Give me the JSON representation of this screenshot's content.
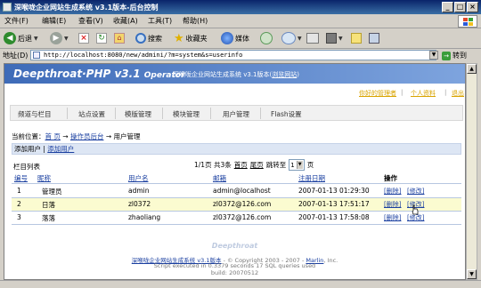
{
  "window": {
    "title": "深喉咙企业网站生成系统 v3.1版本-后台控制"
  },
  "menu": {
    "items": [
      "文件(F)",
      "编辑(E)",
      "查看(V)",
      "收藏(A)",
      "工具(T)",
      "帮助(H)"
    ]
  },
  "toolbar": {
    "back_label": "后退",
    "search_label": "搜索",
    "favorites_label": "收藏夹",
    "media_label": "媒体"
  },
  "address": {
    "label": "地址(D)",
    "url": "http://localhost:8080/new/admini/?m=system&s=userinfo",
    "go_label": "转到"
  },
  "page": {
    "brand": "Deepthroat·PHP v3.1",
    "brand_sub": "Operator",
    "header_text": "深喉咙企业网站生成系统 v3.1版本",
    "header_link": "浏览网站",
    "user_links": {
      "admin": "你好的管理者",
      "profile": "个人资料",
      "logout": "退出"
    },
    "tabs": [
      "频道与栏目",
      "站点设置",
      "模版管理",
      "模块管理",
      "用户管理",
      "Flash设置"
    ],
    "breadcrumb": {
      "prefix": "当前位置：",
      "home": "首 页",
      "sep1": " → ",
      "backend": "操作员后台",
      "sep2": " → ",
      "current": "用户管理"
    },
    "actions": {
      "add_user_label": "添加用户",
      "add_user_link": "添加用户"
    },
    "list_title": "栏目列表",
    "pager": {
      "summary": "1/1页 共3条",
      "first": "首页",
      "last": "尾页",
      "jump_label": "跳转至",
      "page_value": "1",
      "page_suffix": "页"
    },
    "table": {
      "headers": {
        "id": "编号",
        "nickname": "昵称",
        "username": "用户名",
        "email": "邮箱",
        "regdate": "注册日期",
        "ops": "操作"
      },
      "rows": [
        {
          "id": "1",
          "nickname": "管理员",
          "username": "admin",
          "email": "admin@localhost",
          "regdate": "2007-01-13 01:29:30",
          "delete": "[删除]",
          "edit": "[修改]"
        },
        {
          "id": "2",
          "nickname": "日落",
          "username": "zl0372",
          "email": "zl0372@126.com",
          "regdate": "2007-01-13 17:51:17",
          "delete": "[删除]",
          "edit": "[修改]"
        },
        {
          "id": "3",
          "nickname": "落落",
          "username": "zhaoliang",
          "email": "zl0372@126.com",
          "regdate": "2007-01-13 17:58:08",
          "delete": "[删除]",
          "edit": "[修改]"
        }
      ]
    },
    "footer": {
      "brand": "Deepthroat",
      "line1_link": "深喉咙企业网站生成系统 v3.1版本",
      "line1_mid": " - © Copyright 2003 - 2007 - ",
      "line1_marlin": "Marlin",
      "line1_end": ", Inc.",
      "line2": "Script executed in 0.3379 seconds 17 SQL queries used",
      "line3": "build: 20070512"
    }
  },
  "colors": {
    "header_start": "#3e6bb8",
    "header_end": "#7ea4de",
    "link": "#1a3fa0",
    "highlight_row": "#fbfbd0",
    "user_link": "#d9a400"
  }
}
